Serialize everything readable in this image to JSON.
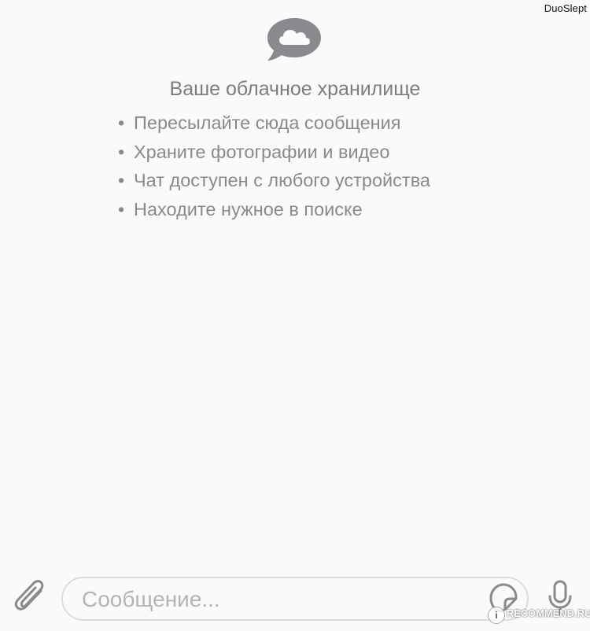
{
  "watermark": {
    "top_right": "DuoSlept",
    "bottom_badge": "RECOMMEND.RU",
    "bottom_badge_logo": "i"
  },
  "empty_state": {
    "icon": "cloud-bubble-icon",
    "title": "Ваше облачное хранилище",
    "bullet_glyph": "•",
    "items": [
      "Пересылайте сюда сообщения",
      "Храните фотографии и видео",
      "Чат доступен с любого устройства",
      "Находите нужное в поиске"
    ]
  },
  "composer": {
    "placeholder": "Сообщение...",
    "value": "",
    "icons": {
      "attach": "paperclip-icon",
      "sticker": "sticker-icon",
      "voice": "microphone-icon"
    }
  },
  "colors": {
    "background": "#fafafa",
    "icon_gray": "#7d7d81",
    "text_gray": "#8a8a8e",
    "input_border": "#dcdcdf",
    "placeholder": "#b4b4b8"
  }
}
